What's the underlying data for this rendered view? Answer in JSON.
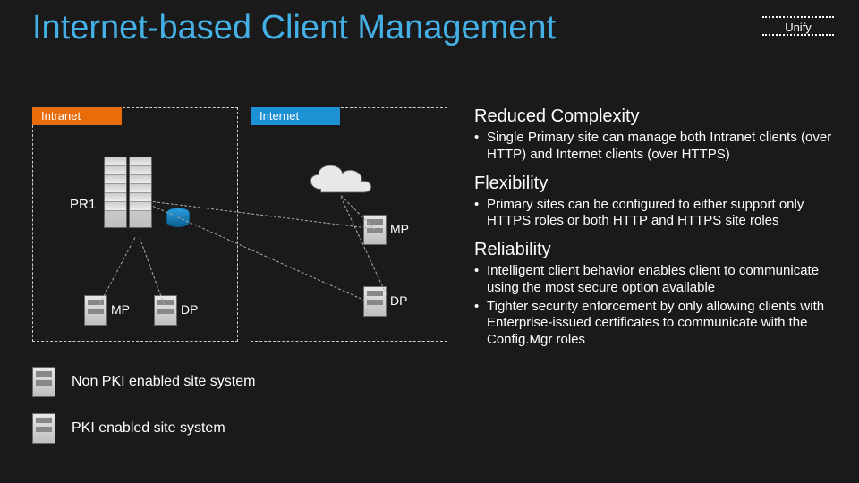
{
  "title": "Internet-based Client Management",
  "badge": "Unify",
  "zones": {
    "intranet": "Intranet",
    "internet": "Internet"
  },
  "labels": {
    "pr1": "PR1",
    "mp": "MP",
    "dp": "DP"
  },
  "legend": {
    "non_pki": "Non PKI enabled site system",
    "pki": "PKI enabled site system"
  },
  "sections": {
    "reduced": {
      "heading": "Reduced Complexity",
      "bullet1": "Single Primary site can manage both Intranet clients (over HTTP) and Internet clients (over HTTPS)"
    },
    "flex": {
      "heading": "Flexibility",
      "bullet1": "Primary sites can be configured to either support only HTTPS roles or both HTTP and HTTPS site roles"
    },
    "rel": {
      "heading": "Reliability",
      "bullet1": "Intelligent client behavior enables client to communicate using the most secure option available",
      "bullet2": "Tighter security enforcement by only allowing clients with Enterprise-issued certificates to communicate with the Config.Mgr roles"
    }
  }
}
